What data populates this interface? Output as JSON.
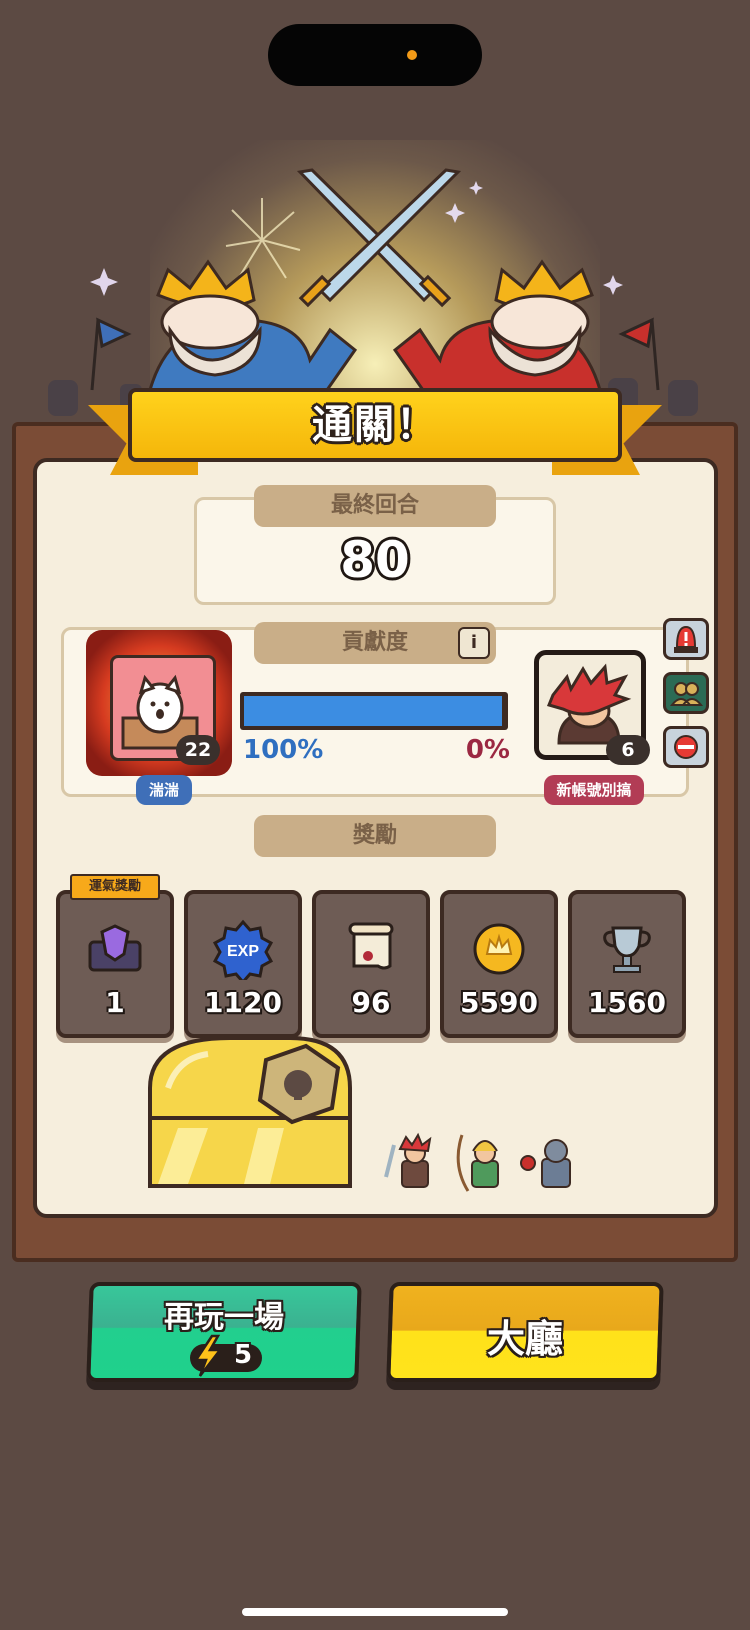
{
  "banner": {
    "title": "通關！"
  },
  "final_round": {
    "label": "最終回合",
    "value": "80"
  },
  "contribution": {
    "label": "貢獻度",
    "info_glyph": "i",
    "player1": {
      "name": "湍湍",
      "level": "22",
      "percent_text": "100%",
      "percent": 100
    },
    "player2": {
      "name": "新帳號別搞",
      "level": "6",
      "percent_text": "0%",
      "percent": 0
    }
  },
  "side_actions": [
    {
      "icon": "report-siren-icon"
    },
    {
      "icon": "add-friend-icon"
    },
    {
      "icon": "block-icon"
    }
  ],
  "rewards": {
    "label": "獎勵",
    "luck_tag": "運氣獎勵",
    "items": [
      {
        "icon": "gem-chest-icon",
        "value": "1"
      },
      {
        "icon": "exp-badge-icon",
        "value": "1120",
        "icon_text": "EXP"
      },
      {
        "icon": "scroll-icon",
        "value": "96"
      },
      {
        "icon": "gold-coin-icon",
        "value": "5590"
      },
      {
        "icon": "trophy-icon",
        "value": "1560"
      }
    ]
  },
  "buttons": {
    "replay": {
      "label": "再玩一場",
      "energy_cost": "5"
    },
    "lobby": {
      "label": "大廳"
    }
  },
  "colors": {
    "background": "#5c4a43",
    "banner": "#ffd21c",
    "progress_blue": "#3c8de2",
    "player2_red": "#9b2842",
    "replay_green": "#22cf8e",
    "lobby_yellow": "#ffe31c"
  }
}
